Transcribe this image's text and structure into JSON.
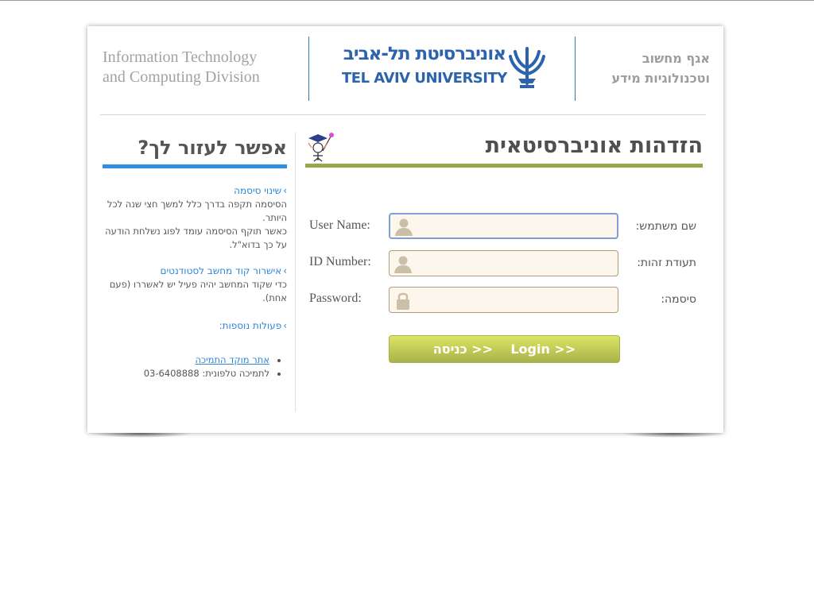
{
  "header": {
    "division_en_line1": "Information Technology",
    "division_en_line2": "and Computing Division",
    "logo_he": "אוניברסיטת תל-אביב",
    "logo_en": "TEL AVIV UNIVERSITY",
    "division_he_line1": "אגף מחשוב",
    "division_he_line2": "וטכנולוגיות מידע"
  },
  "sidebar": {
    "title": "אפשר לעזור לך?",
    "sections": [
      {
        "heading": "שינוי סיסמה",
        "text": "הסיסמה תקפה בדרך כלל למשך חצי שנה לכל היותר.\nכאשר תוקף הסיסמה עומד לפוג נשלחת הודעה על כך בדוא\"ל."
      },
      {
        "heading": "אישרור קוד מחשב לסטודנטים",
        "text": "כדי שקוד המחשב יהיה פעיל יש לאשררו (פעם אחת)."
      },
      {
        "heading": "פעולות נוספות:",
        "text": ""
      }
    ],
    "links": {
      "support_site": "אתר מוקד התמיכה",
      "support_phone": "לתמיכה טלפונית: 03-6408888"
    }
  },
  "main": {
    "title": "הזדהות אוניברסיטאית",
    "fields": {
      "username": {
        "label_en": "User Name:",
        "label_he": "שם משתמש:",
        "value": ""
      },
      "id_number": {
        "label_en": "ID Number:",
        "label_he": "תעודת זהות:",
        "value": ""
      },
      "password": {
        "label_en": "Password:",
        "label_he": "סיסמה:",
        "value": ""
      }
    },
    "login_button": "כניסה >>    Login >>"
  },
  "colors": {
    "accent_blue": "#2f8fe0",
    "accent_olive": "#9aa64b",
    "logo_blue": "#2b63ad",
    "button_top": "#dce563",
    "button_bottom": "#a9b24b"
  },
  "icons": {
    "user": "user-silhouette-icon",
    "password": "lock-icon",
    "sidebar_arrow": "chevron-left-icon"
  }
}
